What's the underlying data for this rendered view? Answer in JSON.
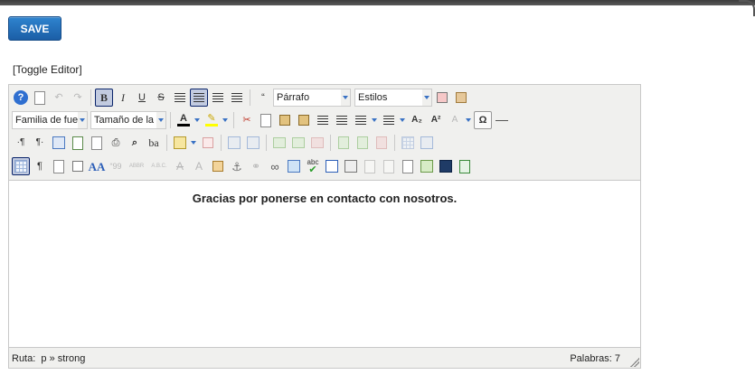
{
  "save_label": "SAVE",
  "toggle_label": "[Toggle Editor]",
  "toolbar": {
    "format_select": "Párrafo",
    "styles_select": "Estilos",
    "font_family_select": "Familia de fuente",
    "font_size_select": "Tamaño de la fuente",
    "glyphs": {
      "bold": "B",
      "italic": "I",
      "underline": "U",
      "strike": "S",
      "help": "?",
      "undo": "↶",
      "redo": "↷",
      "blockquote": "“",
      "pilcrow_ltr": "·¶",
      "pilcrow_rtl": "¶·",
      "visualchars": "¶",
      "print": "⎙",
      "find": "⌕",
      "replace": "ba",
      "cut": "✂",
      "subscript": "A₂",
      "superscript": "A²",
      "charmap": "Ω",
      "color_a": "A",
      "abbr": "ABBR",
      "acronym": "A.B.C.",
      "del": "A",
      "ins": "A",
      "spell": "abc",
      "quote": "«»"
    }
  },
  "content_text": "Gracias por ponerse en contacto con nosotros.",
  "status": {
    "path_label": "Ruta:",
    "path_value": "p » strong",
    "words": "Palabras: 7"
  },
  "colors": {
    "save_bg": "#1f66b0",
    "active_button": "#c2cbe0",
    "toolbar_bg": "#f0f0ee"
  }
}
